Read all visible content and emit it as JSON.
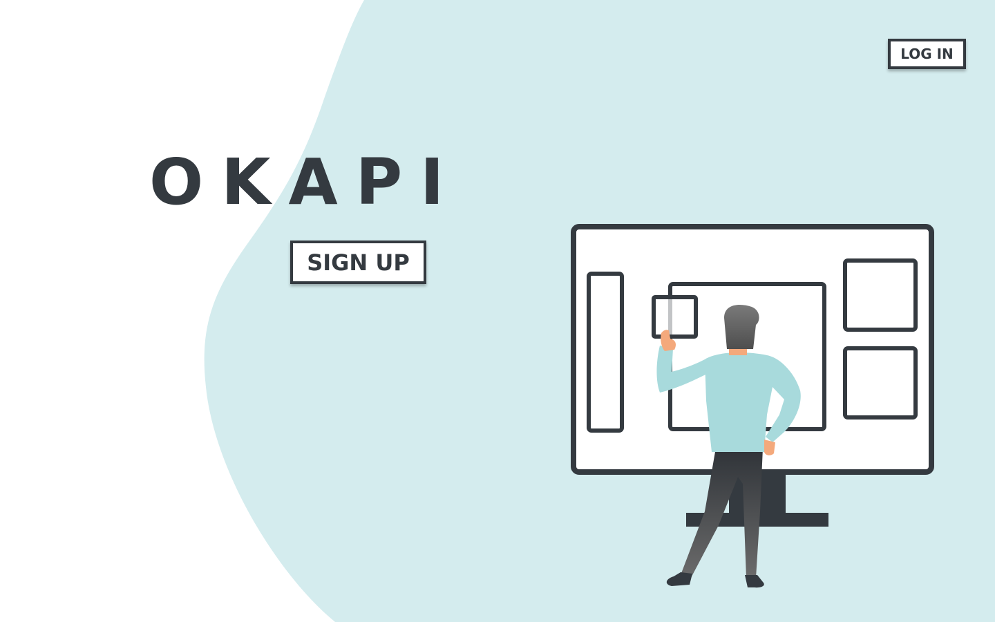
{
  "brand": {
    "name": "OKAPI"
  },
  "header": {
    "login_label": "LOG IN"
  },
  "hero": {
    "signup_label": "SIGN UP",
    "illustration_icon": "person-at-monitor-illustration"
  },
  "colors": {
    "background": "#ffffff",
    "blob": "#d4ecee",
    "text": "#343a40",
    "shirt": "#a8dadc",
    "skin": "#f4a97c",
    "hair": "#5c5c5c"
  }
}
